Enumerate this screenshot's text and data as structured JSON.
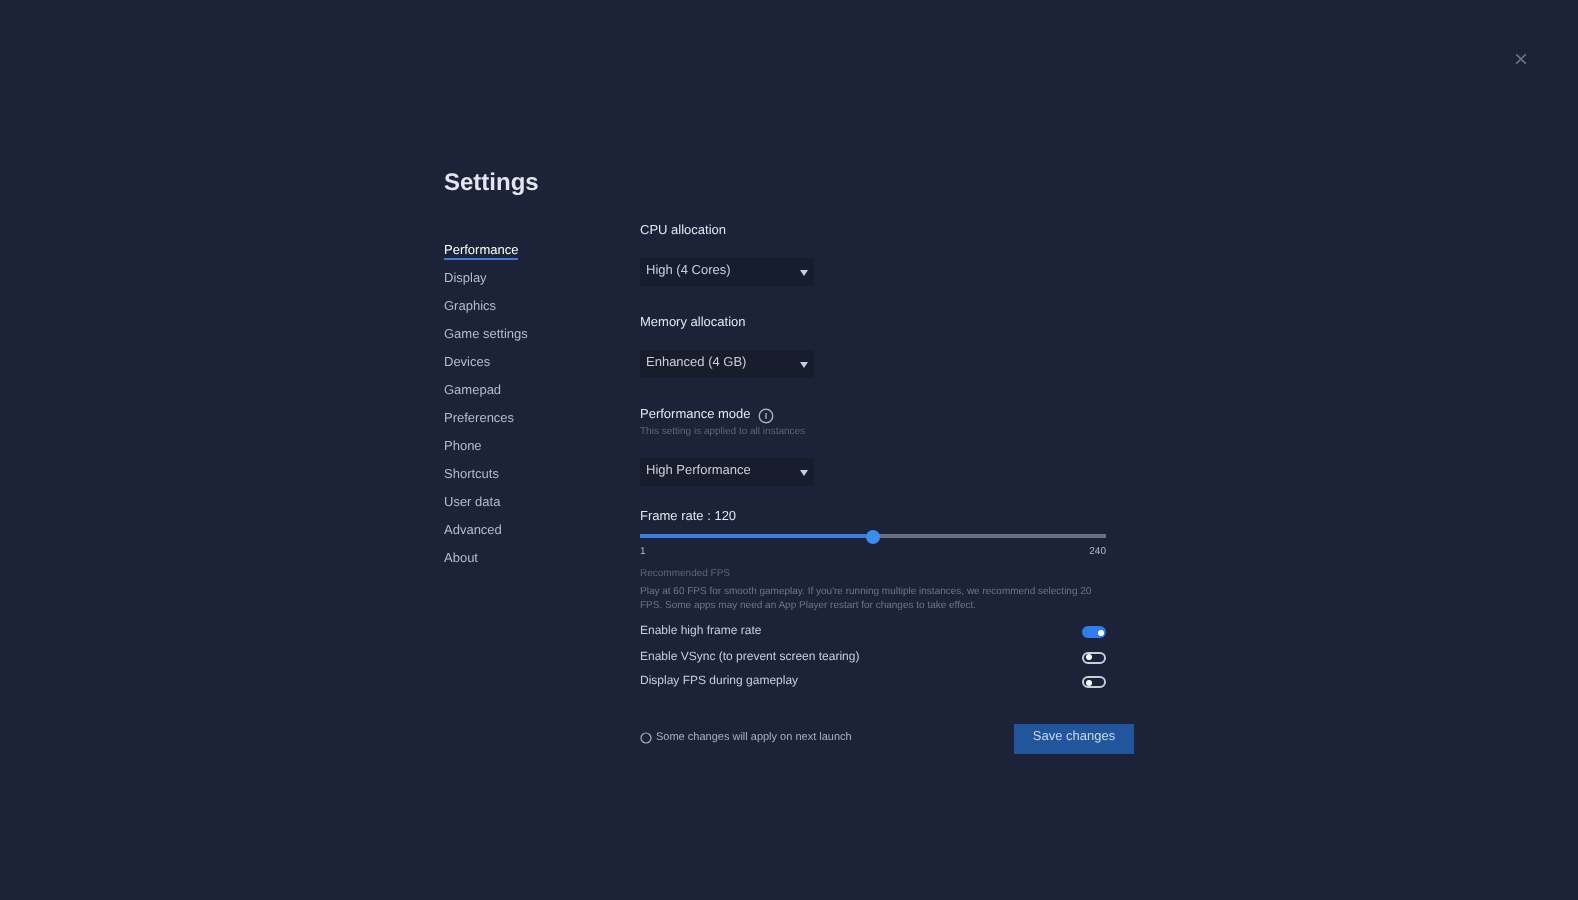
{
  "title": "Settings",
  "sidebar": {
    "items": [
      {
        "label": "Performance",
        "selected": true
      },
      {
        "label": "Display",
        "selected": false
      },
      {
        "label": "Graphics",
        "selected": false
      },
      {
        "label": "Game settings",
        "selected": false
      },
      {
        "label": "Devices",
        "selected": false
      },
      {
        "label": "Gamepad",
        "selected": false
      },
      {
        "label": "Preferences",
        "selected": false
      },
      {
        "label": "Phone",
        "selected": false
      },
      {
        "label": "Shortcuts",
        "selected": false
      },
      {
        "label": "User data",
        "selected": false
      },
      {
        "label": "Advanced",
        "selected": false
      },
      {
        "label": "About",
        "selected": false
      }
    ]
  },
  "cpu": {
    "label": "CPU allocation",
    "value": "High (4 Cores)"
  },
  "memory": {
    "label": "Memory allocation",
    "value": "Enhanced (4 GB)"
  },
  "mode": {
    "label": "Performance mode",
    "hint": "This setting is applied to all instances",
    "value": "High Performance"
  },
  "frame_rate": {
    "label": "Frame rate : 120",
    "level": 0.5,
    "min": "1",
    "max": "240"
  },
  "recommendation": {
    "title": "Recommended FPS",
    "text": "Play at 60 FPS for smooth gameplay. If you're running multiple instances, we recommend selecting 20 FPS. Some apps may need an App Player restart for changes to take effect."
  },
  "toggles": [
    {
      "label": "Enable high frame rate",
      "on": true
    },
    {
      "label": "Enable VSync (to prevent screen tearing)",
      "on": false
    },
    {
      "label": "Display FPS during gameplay",
      "on": false
    }
  ],
  "footer": {
    "note": "Some changes will apply on next launch",
    "button": "Save changes"
  }
}
